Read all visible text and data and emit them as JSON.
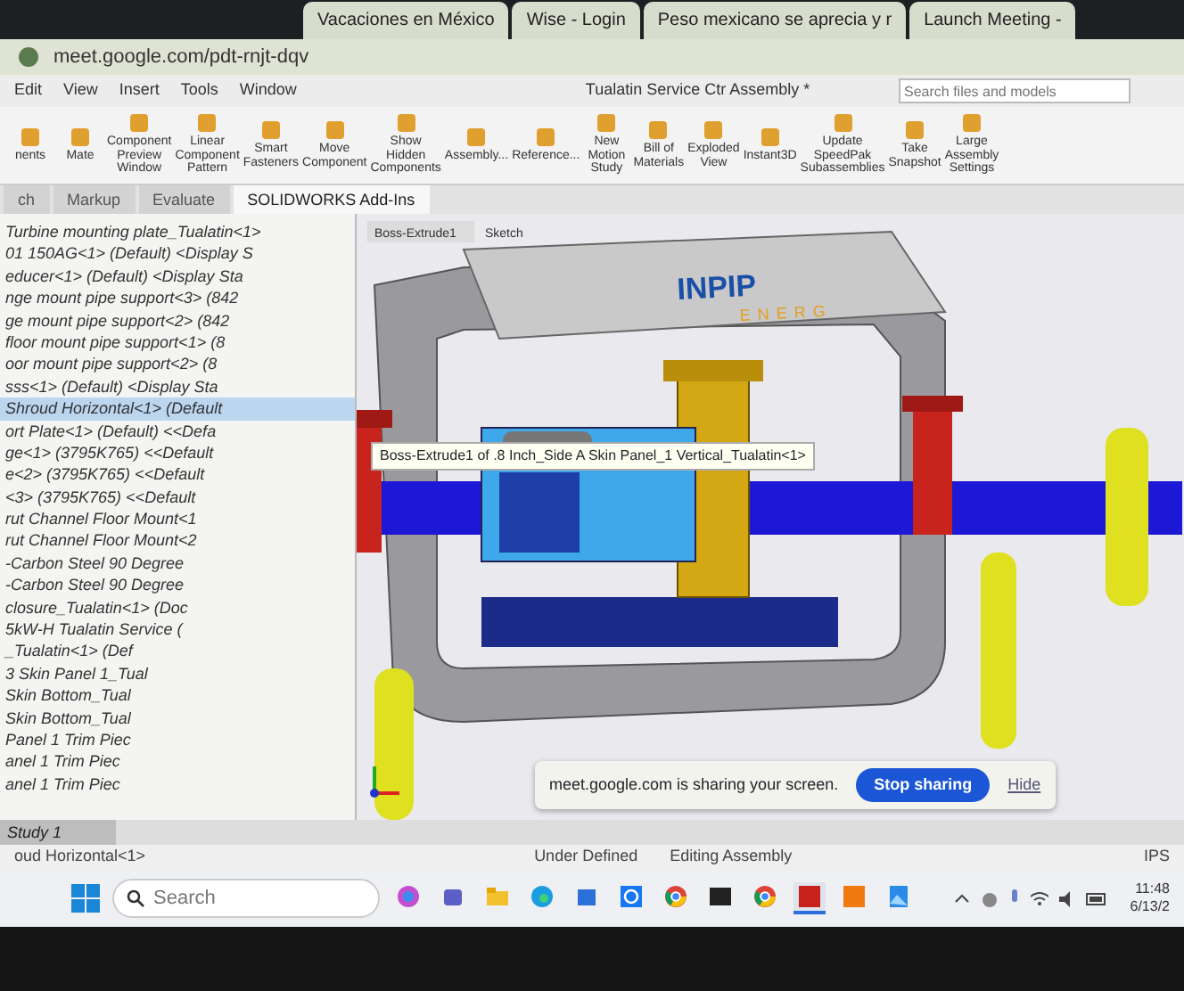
{
  "browser": {
    "tabs": [
      "Vacaciones en México",
      "Wise - Login",
      "Peso mexicano se aprecia y r",
      "Launch Meeting -"
    ],
    "address": "meet.google.com/pdt-rnjt-dqv"
  },
  "app": {
    "menu": [
      "Edit",
      "View",
      "Insert",
      "Tools",
      "Window"
    ],
    "title": "Tualatin Service Ctr Assembly *",
    "search_placeholder": "Search files and models",
    "ribbon": [
      "nents",
      "Mate",
      "Component Preview Window",
      "Linear Component Pattern",
      "Smart Fasteners",
      "Move Component",
      "Show Hidden Components",
      "Assembly...",
      "Reference...",
      "New Motion Study",
      "Bill of Materials",
      "Exploded View",
      "Instant3D",
      "Update SpeedPak Subassemblies",
      "Take Snapshot",
      "Large Assembly Settings"
    ],
    "command_tabs": [
      {
        "label": "ch",
        "selected": false
      },
      {
        "label": "Markup",
        "selected": false
      },
      {
        "label": "Evaluate",
        "selected": false
      },
      {
        "label": "SOLIDWORKS Add-Ins",
        "selected": true
      }
    ]
  },
  "tree": [
    {
      "label": "Turbine mounting plate_Tualatin<1>",
      "selected": false
    },
    {
      "label": "01 150AG<1> (Default) <Display S",
      "selected": false
    },
    {
      "label": "educer<1> (Default) <Display Sta",
      "selected": false
    },
    {
      "label": "nge mount pipe support<3> (842",
      "selected": false
    },
    {
      "label": "ge mount pipe support<2> (842",
      "selected": false
    },
    {
      "label": "floor mount pipe support<1> (8",
      "selected": false
    },
    {
      "label": "oor mount pipe support<2> (8",
      "selected": false
    },
    {
      "label": "sss<1> (Default) <Display Sta",
      "selected": false
    },
    {
      "label": "Shroud Horizontal<1> (Default",
      "selected": true
    },
    {
      "label": "ort Plate<1> (Default) <<Defa",
      "selected": false
    },
    {
      "label": "ge<1> (3795K765) <<Default",
      "selected": false
    },
    {
      "label": "e<2> (3795K765) <<Default",
      "selected": false
    },
    {
      "label": "<3> (3795K765) <<Default",
      "selected": false
    },
    {
      "label": "rut Channel Floor Mount<1",
      "selected": false
    },
    {
      "label": "rut Channel Floor Mount<2",
      "selected": false
    },
    {
      "label": "-Carbon Steel 90 Degree",
      "selected": false
    },
    {
      "label": "-Carbon Steel 90 Degree",
      "selected": false
    },
    {
      "label": "closure_Tualatin<1> (Doc",
      "selected": false
    },
    {
      "label": "5kW-H Tualatin Service (",
      "selected": false
    },
    {
      "label": "_Tualatin<1> (Def",
      "selected": false
    },
    {
      "label": "3 Skin Panel 1_Tual",
      "selected": false
    },
    {
      "label": "Skin Bottom_Tual",
      "selected": false
    },
    {
      "label": "Skin Bottom_Tual",
      "selected": false
    },
    {
      "label": "Panel 1 Trim Piec",
      "selected": false
    },
    {
      "label": "anel 1 Trim Piec",
      "selected": false
    },
    {
      "label": "anel 1 Trim Piec",
      "selected": false
    }
  ],
  "viewport": {
    "chips": [
      "Boss-Extrude1",
      "Sketch"
    ],
    "logo_top": "INPIP",
    "logo_bottom": "ENERG",
    "tooltip": "Boss-Extrude1 of .8 Inch_Side A Skin Panel_1 Vertical_Tualatin<1>"
  },
  "sharing": {
    "message": "meet.google.com is sharing your screen.",
    "stop": "Stop sharing",
    "hide": "Hide"
  },
  "study_tab": "Study 1",
  "status": {
    "left": "oud Horizontal<1>",
    "state": "Under Defined",
    "mode": "Editing Assembly",
    "units": "IPS"
  },
  "taskbar": {
    "search_placeholder": "Search",
    "apps": [
      {
        "kind": "copilot",
        "selected": false
      },
      {
        "kind": "teams",
        "selected": false
      },
      {
        "kind": "folder",
        "selected": false
      },
      {
        "kind": "edge",
        "selected": false
      },
      {
        "kind": "store",
        "selected": false
      },
      {
        "kind": "ring",
        "selected": false
      },
      {
        "kind": "chrome",
        "selected": false
      },
      {
        "kind": "terminal",
        "selected": false
      },
      {
        "kind": "chrome",
        "selected": false
      },
      {
        "kind": "cad",
        "selected": true
      },
      {
        "kind": "orange",
        "selected": false
      },
      {
        "kind": "photos",
        "selected": false
      }
    ],
    "time": "11:48",
    "date": "6/13/2"
  }
}
